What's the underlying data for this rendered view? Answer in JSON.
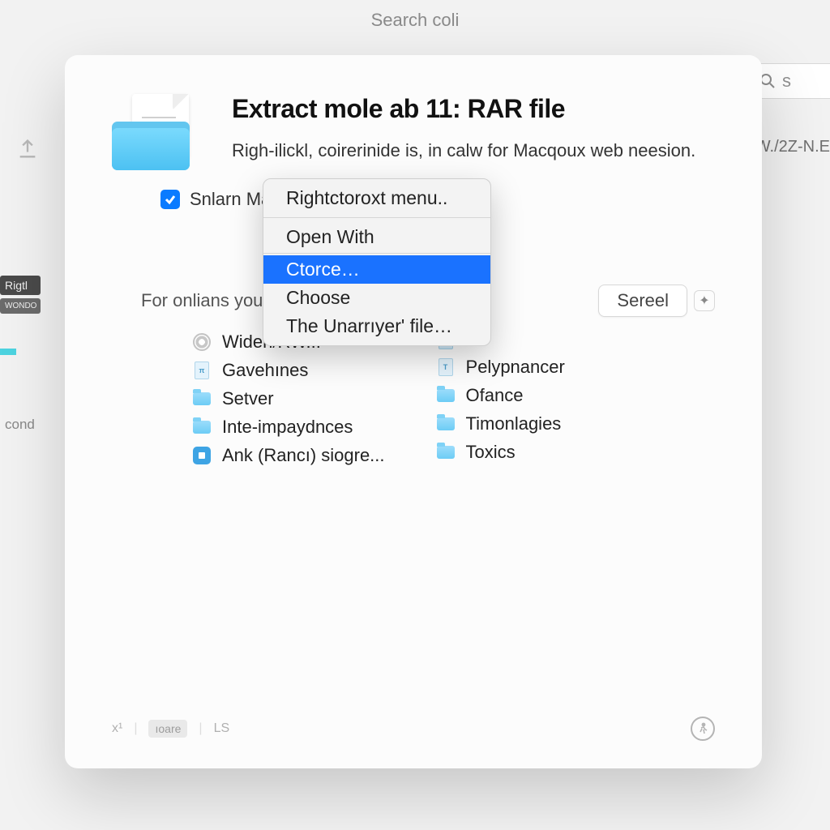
{
  "top_search_placeholder": "Search coli",
  "right_search_text": "s",
  "right_edge_text": "W./2Z-N.E",
  "left_panel": {
    "rightl": "Rigtl",
    "wondo": "WONDO",
    "cond": "cond"
  },
  "dialog": {
    "title": "Extract mole ab 11: RAR file",
    "subtitle": "Righ-ilickl, coirerinide is, in calw for Macqoux web neesion.",
    "checkbox_label": "Snlarn Mane",
    "section_label": "For onlians you| ab",
    "sereel_btn": "Sereel",
    "left_files": [
      {
        "icon": "gear",
        "label": "Widen/RW..."
      },
      {
        "icon": "doc-t",
        "label": "Gavehınes"
      },
      {
        "icon": "folder",
        "label": "Setver"
      },
      {
        "icon": "folder",
        "label": "Inte-impaydnces"
      },
      {
        "icon": "app",
        "label": "Ank (Rancı) siogre..."
      }
    ],
    "right_files": [
      {
        "icon": "doc",
        "label": ""
      },
      {
        "icon": "doc-t",
        "label": "Pelypnancer"
      },
      {
        "icon": "folder",
        "label": "Ofance"
      },
      {
        "icon": "folder",
        "label": "Timonlagies"
      },
      {
        "icon": "folder",
        "label": "Toxics"
      }
    ],
    "footer": {
      "x_label": "x¹",
      "chip": "ıoare",
      "ls": "LS"
    }
  },
  "context_menu": {
    "items": [
      "Rightctoroxt menu..",
      "Open With",
      "Ctorce…",
      "Choose",
      "The Unarrıyer' file…"
    ],
    "highlighted_index": 2
  }
}
